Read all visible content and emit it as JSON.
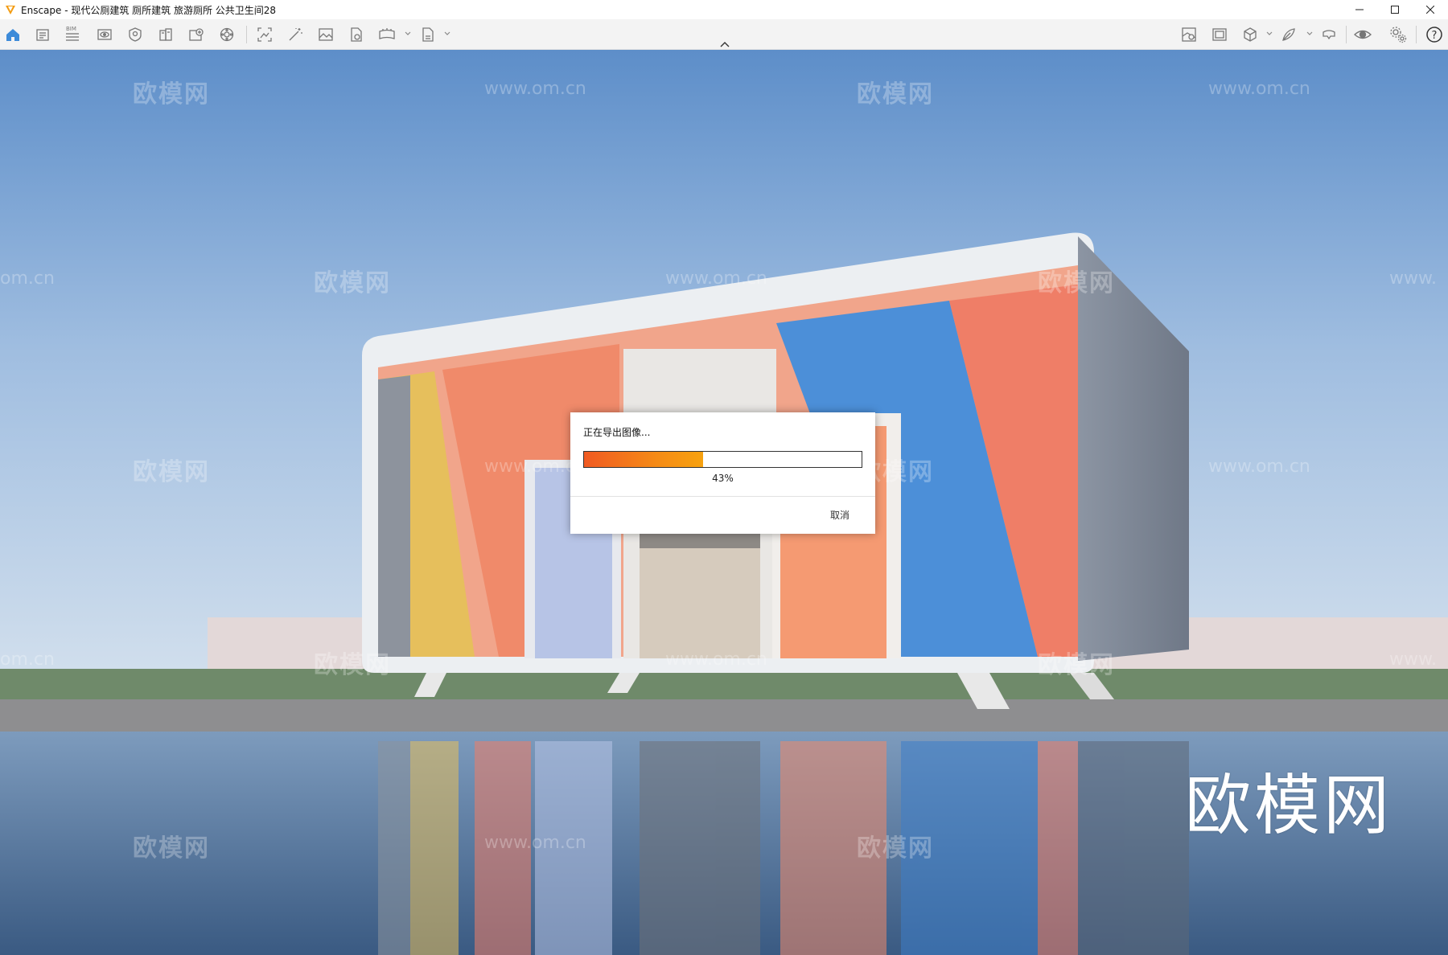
{
  "window": {
    "title": "Enscape - 现代公厕建筑 厕所建筑 旅游厕所 公共卫生间28"
  },
  "toolbar": {
    "icons": [
      "home-icon",
      "notes-icon",
      "bim-icon",
      "view-icon",
      "safe-frame-icon",
      "building-icon",
      "asset-library-icon",
      "settings-sphere-icon",
      "screenshot-icon",
      "magic-wand-icon",
      "image-icon",
      "export-file-icon",
      "panorama-icon",
      "exe-export-icon",
      "map-icon",
      "gallery-icon",
      "cube-icon",
      "feather-icon",
      "vr-headset-icon",
      "visibility-icon",
      "gear-icon",
      "help-icon"
    ],
    "bim_label": "BIM"
  },
  "dialog": {
    "title": "正在导出图像...",
    "progress": 0.43,
    "percent_label": "43%",
    "cancel_label": "取消"
  },
  "watermarks": {
    "logo_text": "欧模网",
    "url_text": "www.om.cn",
    "url_fragment_left": "om.cn",
    "url_fragment_right": "www.",
    "big_text": "欧模网"
  },
  "colors": {
    "accent": "#3d8bd9",
    "progress_start": "#f05a22",
    "progress_end": "#f7a20f",
    "sky_top": "#5f8fc9",
    "water": "#3f5f86"
  }
}
